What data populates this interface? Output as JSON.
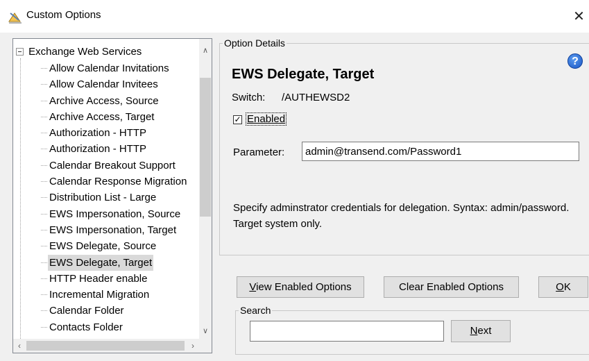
{
  "window": {
    "title": "Custom Options",
    "close_glyph": "✕"
  },
  "tree": {
    "root_label": "Exchange Web Services",
    "items": [
      "Allow Calendar Invitations",
      "Allow Calendar Invitees",
      "Archive Access, Source",
      "Archive Access, Target",
      "Authorization - HTTP",
      "Authorization - HTTP",
      "Calendar Breakout Support",
      "Calendar Response Migration",
      "Distribution List - Large",
      "EWS Impersonation, Source",
      "EWS Impersonation, Target",
      "EWS Delegate, Source",
      "EWS Delegate, Target",
      "HTTP Header enable",
      "Incremental Migration",
      "Calendar Folder",
      "Contacts Folder"
    ],
    "selected_index": 12
  },
  "details": {
    "legend": "Option Details",
    "title": "EWS Delegate, Target",
    "switch_label": "Switch:",
    "switch_value": "/AUTHEWSD2",
    "enabled_checked": true,
    "enabled_label": "Enabled",
    "parameter_label": "Parameter:",
    "parameter_value": "admin@transend.com/Password1",
    "description": "Specify adminstrator credentials for delegation. Syntax: admin/password. Target system only."
  },
  "buttons": {
    "view_enabled": "View Enabled Options",
    "clear_enabled": "Clear Enabled Options",
    "ok": "OK"
  },
  "search": {
    "legend": "Search",
    "value": "",
    "next_label": "Next"
  },
  "icons": {
    "app": "options-app-icon",
    "help": "help-icon",
    "help_glyph": "?"
  },
  "colors": {
    "help_blue": "#1a56c4",
    "selection": "#d9d9d9"
  }
}
